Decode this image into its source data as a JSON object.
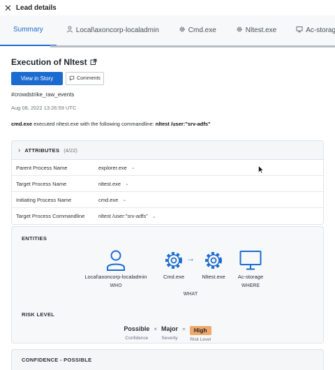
{
  "panel": {
    "close_label": "✕",
    "title": "Lead details"
  },
  "tabs": [
    {
      "label": "Summary",
      "icon": "none",
      "active": true
    },
    {
      "label": "Local\\axoncorp-localadmin",
      "icon": "user-icon"
    },
    {
      "label": "Cmd.exe",
      "icon": "gear-icon"
    },
    {
      "label": "Nltest.exe",
      "icon": "gear-icon"
    },
    {
      "label": "Ac-storage",
      "icon": "monitor-icon"
    }
  ],
  "detail": {
    "title": "Execution of Nltest",
    "view_story": "View in Story",
    "comments": "Comments",
    "tag": "#crowdstrike_raw_events",
    "timestamp": "Aug 08, 2022 13:26:59 UTC",
    "cmd_prefix": "cmd.exe",
    "cmd_middle": " executed nltest.exe with the following commandline: ",
    "cmd_value": "nltest /user:\"srv-adfs\""
  },
  "attributes": {
    "label": "ATTRIBUTES",
    "count": "(4/22)",
    "rows": [
      {
        "key": "Parent Process Name",
        "value": "explorer.exe"
      },
      {
        "key": "Target Process Name",
        "value": "nltest.exe"
      },
      {
        "key": "Initiating Process Name",
        "value": "cmd.exe"
      },
      {
        "key": "Target Process Commandline",
        "value": "nltest /user:\"srv-adfs\""
      }
    ]
  },
  "entities": {
    "title": "ENTITIES",
    "who": {
      "name": "Local\\axoncorp-localadmin",
      "role": "WHO"
    },
    "what1": {
      "name": "Cmd.exe"
    },
    "what2": {
      "name": "Nltest.exe"
    },
    "what_role": "WHAT",
    "where": {
      "name": "Ac-storage",
      "role": "WHERE"
    },
    "arrow": "→"
  },
  "risk": {
    "title": "RISK LEVEL",
    "confidence_value": "Possible",
    "confidence_label": "Confidence",
    "times": "×",
    "severity_value": "Major",
    "severity_label": "Severity",
    "equals": "=",
    "risk_value": "High",
    "risk_label": "Risk Level"
  },
  "confidence": {
    "title": "CONFIDENCE - POSSIBLE"
  },
  "colors": {
    "accent": "#1c6bd0",
    "high_badge": "#f0a86b"
  }
}
